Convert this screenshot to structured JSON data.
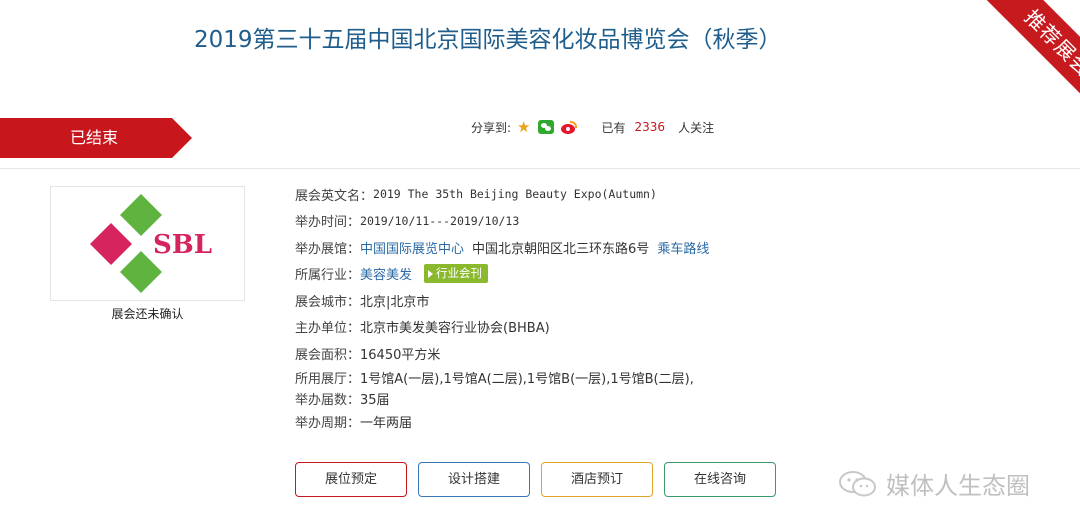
{
  "header": {
    "title": "2019第三十五届中国北京国际美容化妆品博览会（秋季）",
    "corner_ribbon": "推荐展会"
  },
  "status": {
    "label": "已结束"
  },
  "share": {
    "label": "分享到:",
    "icons": [
      "star-icon",
      "wechat-icon",
      "weibo-icon"
    ],
    "prefix": "已有",
    "count": "2336",
    "suffix": "人关注"
  },
  "logo": {
    "text": "SBL",
    "caption": "展会还未确认"
  },
  "info": {
    "english_name": {
      "label": "展会英文名：",
      "value": "2019 The 35th Beijing Beauty Expo(Autumn)"
    },
    "dates": {
      "label": "举办时间：",
      "value": "2019/10/11---2019/10/13"
    },
    "venue": {
      "label": "举办展馆：",
      "venue_link": "中国国际展览中心",
      "address": "中国北京朝阳区北三环东路6号",
      "route_link": "乘车路线"
    },
    "industry": {
      "label": "所属行业：",
      "value": "美容美发",
      "tag": "行业会刊"
    },
    "city": {
      "label": "展会城市：",
      "value": "北京|北京市"
    },
    "organizer": {
      "label": "主办单位：",
      "value": "北京市美发美容行业协会(BHBA)"
    },
    "area": {
      "label": "展会面积：",
      "value": "16450平方米"
    },
    "halls": {
      "label": "所用展厅：",
      "value": "1号馆A(一层),1号馆A(二层),1号馆B(一层),1号馆B(二层),"
    },
    "sessions": {
      "label": "举办届数：",
      "value": "35届"
    },
    "cycle": {
      "label": "举办周期：",
      "value": "一年两届"
    }
  },
  "buttons": {
    "booth": "展位预定",
    "design": "设计搭建",
    "hotel": "酒店预订",
    "consult": "在线咨询"
  },
  "watermark": {
    "text": "媒体人生态圈"
  },
  "colors": {
    "accent_red": "#c8161d",
    "title_blue": "#1e5d8c",
    "link_blue": "#2a6aa5",
    "logo_green": "#5fb33f",
    "logo_pink": "#d6245e"
  }
}
